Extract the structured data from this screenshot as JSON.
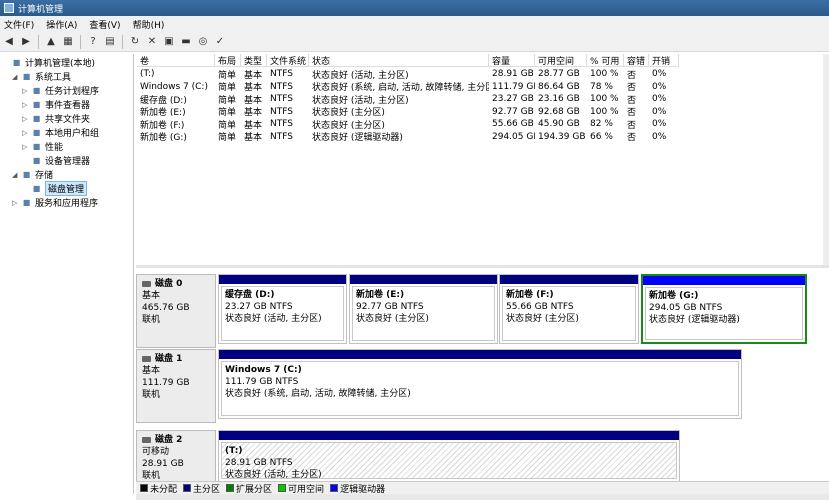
{
  "window": {
    "title": "计算机管理"
  },
  "menu": [
    "文件(F)",
    "操作(A)",
    "查看(V)",
    "帮助(H)"
  ],
  "toolbar": [
    {
      "icon": "back-arrow-icon",
      "glyph": "◀"
    },
    {
      "icon": "forward-arrow-icon",
      "glyph": "▶"
    },
    {
      "icon": "up-folder-icon",
      "glyph": "▲"
    },
    {
      "icon": "show-tree-icon",
      "glyph": "▦"
    },
    {
      "icon": "help-icon",
      "glyph": "?"
    },
    {
      "icon": "console-icon",
      "glyph": "▤"
    },
    {
      "icon": "refresh-icon",
      "glyph": "↻"
    },
    {
      "icon": "delete-icon",
      "glyph": "✕"
    },
    {
      "icon": "properties-icon",
      "glyph": "▣"
    },
    {
      "icon": "open-icon",
      "glyph": "▬"
    },
    {
      "icon": "search-icon",
      "glyph": "◎"
    },
    {
      "icon": "check-icon",
      "glyph": "✓"
    }
  ],
  "tree": [
    {
      "label": "计算机管理(本地)",
      "icon": "computer-icon",
      "arrow": "",
      "level": 0
    },
    {
      "label": "系统工具",
      "icon": "tools-icon",
      "arrow": "◢",
      "level": 1
    },
    {
      "label": "任务计划程序",
      "icon": "clock-icon",
      "arrow": "▷",
      "level": 2
    },
    {
      "label": "事件查看器",
      "icon": "event-viewer-icon",
      "arrow": "▷",
      "level": 2
    },
    {
      "label": "共享文件夹",
      "icon": "shared-folder-icon",
      "arrow": "▷",
      "level": 2
    },
    {
      "label": "本地用户和组",
      "icon": "users-icon",
      "arrow": "▷",
      "level": 2
    },
    {
      "label": "性能",
      "icon": "performance-icon",
      "arrow": "▷",
      "level": 2
    },
    {
      "label": "设备管理器",
      "icon": "device-manager-icon",
      "arrow": "",
      "level": 2
    },
    {
      "label": "存储",
      "icon": "storage-icon",
      "arrow": "◢",
      "level": 1
    },
    {
      "label": "磁盘管理",
      "icon": "disk-management-icon",
      "arrow": "",
      "level": 2,
      "selected": true
    },
    {
      "label": "服务和应用程序",
      "icon": "services-icon",
      "arrow": "▷",
      "level": 1
    }
  ],
  "volumes": {
    "headers": [
      "卷",
      "布局",
      "类型",
      "文件系统",
      "状态",
      "容量",
      "可用空间",
      "% 可用",
      "容错",
      "开销"
    ],
    "rows": [
      [
        "(T:)",
        "简单",
        "基本",
        "NTFS",
        "状态良好 (活动, 主分区)",
        "28.91 GB",
        "28.77 GB",
        "100 %",
        "否",
        "0%"
      ],
      [
        "Windows 7 (C:)",
        "简单",
        "基本",
        "NTFS",
        "状态良好 (系统, 启动, 活动, 故障转储, 主分区)",
        "111.79 GB",
        "86.64 GB",
        "78 %",
        "否",
        "0%"
      ],
      [
        "缓存盘 (D:)",
        "简单",
        "基本",
        "NTFS",
        "状态良好 (活动, 主分区)",
        "23.27 GB",
        "23.16 GB",
        "100 %",
        "否",
        "0%"
      ],
      [
        "新加卷 (E:)",
        "简单",
        "基本",
        "NTFS",
        "状态良好 (主分区)",
        "92.77 GB",
        "92.68 GB",
        "100 %",
        "否",
        "0%"
      ],
      [
        "新加卷 (F:)",
        "简单",
        "基本",
        "NTFS",
        "状态良好 (主分区)",
        "55.66 GB",
        "45.90 GB",
        "82 %",
        "否",
        "0%"
      ],
      [
        "新加卷 (G:)",
        "简单",
        "基本",
        "NTFS",
        "状态良好 (逻辑驱动器)",
        "294.05 GB",
        "194.39 GB",
        "66 %",
        "否",
        "0%"
      ]
    ]
  },
  "disks": [
    {
      "name": "磁盘 0",
      "type": "基本",
      "size": "465.76 GB",
      "status": "联机",
      "partitions": [
        {
          "name": "缓存盘 (D:)",
          "size": "23.27 GB NTFS",
          "status": "状态良好 (活动, 主分区)"
        },
        {
          "name": "新加卷 (E:)",
          "size": "92.77 GB NTFS",
          "status": "状态良好 (主分区)"
        },
        {
          "name": "新加卷 (F:)",
          "size": "55.66 GB NTFS",
          "status": "状态良好 (主分区)"
        },
        {
          "name": "新加卷 (G:)",
          "size": "294.05 GB NTFS",
          "status": "状态良好 (逻辑驱动器)"
        }
      ]
    },
    {
      "name": "磁盘 1",
      "type": "基本",
      "size": "111.79 GB",
      "status": "联机",
      "partitions": [
        {
          "name": "Windows 7 (C:)",
          "size": "111.79 GB NTFS",
          "status": "状态良好 (系统, 启动, 活动, 故障转储, 主分区)"
        }
      ]
    },
    {
      "name": "磁盘 2",
      "type": "可移动",
      "size": "28.91 GB",
      "status": "联机",
      "partitions": [
        {
          "name": "(T:)",
          "size": "28.91 GB NTFS",
          "status": "状态良好 (活动, 主分区)"
        }
      ]
    }
  ],
  "legend": [
    {
      "label": "未分配",
      "color": "#000000"
    },
    {
      "label": "主分区",
      "color": "#000080"
    },
    {
      "label": "扩展分区",
      "color": "#008000"
    },
    {
      "label": "可用空间",
      "color": "#00cc00"
    },
    {
      "label": "逻辑驱动器",
      "color": "#0000ff"
    }
  ]
}
